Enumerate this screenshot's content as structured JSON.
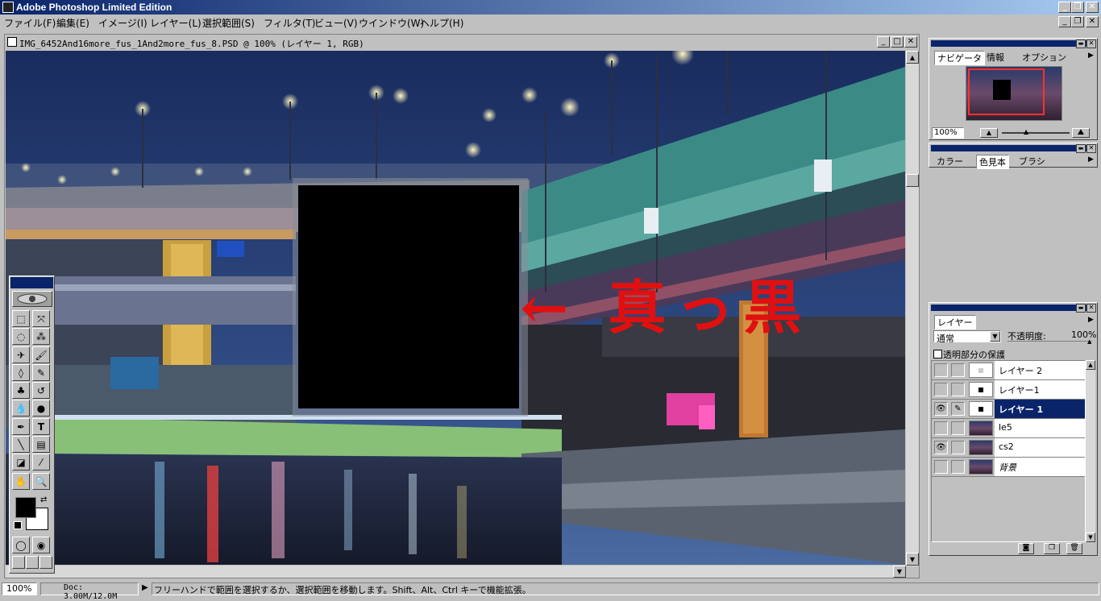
{
  "app": {
    "title": "Adobe Photoshop Limited Edition"
  },
  "menu": [
    "ファイル(F)",
    "編集(E)",
    "イメージ(I)",
    "レイヤー(L)",
    "選択範囲(S)",
    "フィルタ(T)",
    "ビュー(V)",
    "ウインドウ(W)",
    "ヘルプ(H)"
  ],
  "document": {
    "title": "IMG_6452And16more_fus_1And2more_fus_8.PSD @ 100% (レイヤー 1, RGB)",
    "annotation": "← 真っ黒"
  },
  "navigator": {
    "tabs": [
      "ナビゲータ",
      "情報",
      "オプション"
    ],
    "zoom": "100%"
  },
  "color_palette": {
    "tabs": [
      "カラー",
      "色見本",
      "ブラシ"
    ]
  },
  "layers": {
    "tab": "レイヤー",
    "blend_mode": "通常",
    "opacity_label": "不透明度:",
    "opacity_value": "100%",
    "preserve_label": "透明部分の保護",
    "items": [
      {
        "name": "レイヤー 2",
        "visible": false,
        "selected": false
      },
      {
        "name": "レイヤー1",
        "visible": false,
        "selected": false
      },
      {
        "name": "レイヤー 1",
        "visible": true,
        "selected": true
      },
      {
        "name": "le5",
        "visible": false,
        "selected": false
      },
      {
        "name": "cs2",
        "visible": true,
        "selected": false
      },
      {
        "name": "背景",
        "visible": false,
        "selected": false
      }
    ]
  },
  "status": {
    "zoom": "100%",
    "doc": "Doc: 3.00M/12.0M",
    "message": "フリーハンドで範囲を選択するか、選択範囲を移動します。Shift、Alt、Ctrl キーで機能拡張。"
  },
  "colors": {
    "title_active": "#0a246a",
    "selected_layer": "#0a246a",
    "annotation": "#e01010"
  }
}
